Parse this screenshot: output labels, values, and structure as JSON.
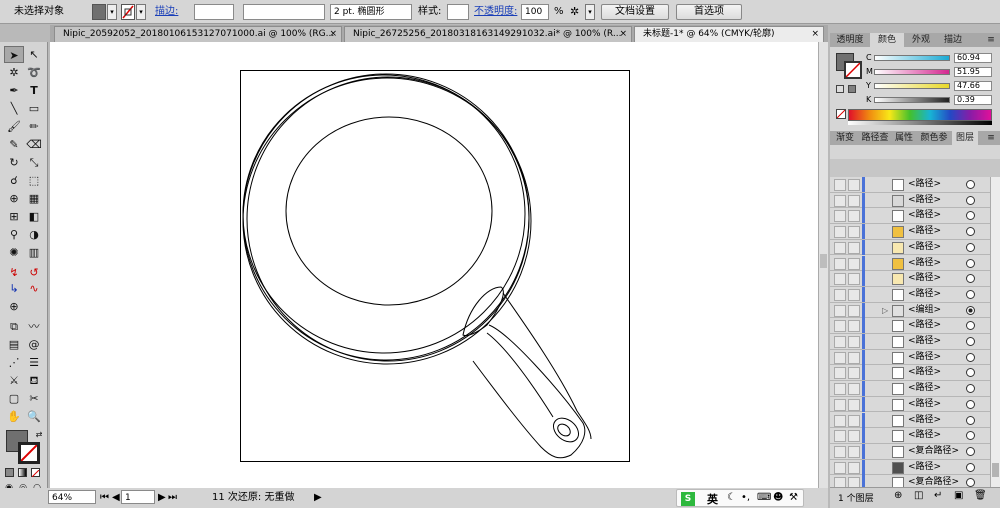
{
  "control_bar": {
    "selection_status": "未选择对象",
    "stroke_label": "描边:",
    "stroke_brush": "2 pt. 椭圆形",
    "style_label": "样式:",
    "opacity_label": "不透明度:",
    "opacity_value": "100",
    "opacity_unit": "%",
    "doc_setup_button": "文档设置",
    "prefs_button": "首选项",
    "fill_color": "#707070"
  },
  "document_tabs": [
    {
      "label": "Nipic_20592052_20180106153127071000.ai @ 100% (RG..."
    },
    {
      "label": "Nipic_26725256_20180318163149291032.ai* @ 100% (R..."
    },
    {
      "label": "未标题-1* @ 64% (CMYK/轮廓)"
    }
  ],
  "status_bar": {
    "zoom": "64%",
    "artboard_number": "1",
    "history": "11 次还原: 无重做"
  },
  "color_panel": {
    "tabs": [
      "透明度",
      "颜色",
      "外观",
      "描边"
    ],
    "active_tab": "颜色",
    "sliders": [
      {
        "channel": "C",
        "value": "60.94",
        "color": "#1aaad4"
      },
      {
        "channel": "M",
        "value": "51.95",
        "color": "#d42890"
      },
      {
        "channel": "Y",
        "value": "47.66",
        "color": "#e8d828"
      },
      {
        "channel": "K",
        "value": "0.39",
        "color": "#222222"
      }
    ]
  },
  "layers_panel": {
    "tabs": [
      "渐变",
      "路径查",
      "属性",
      "颜色参",
      "图层"
    ],
    "active_tab": "图层",
    "rows": [
      {
        "name": "<路径>",
        "thumb": "#ffffff",
        "target": "open"
      },
      {
        "name": "<路径>",
        "thumb": "#d8d8d8",
        "target": "open"
      },
      {
        "name": "<路径>",
        "thumb": "#ffffff",
        "target": "open"
      },
      {
        "name": "<路径>",
        "thumb": "#f0c040",
        "target": "open"
      },
      {
        "name": "<路径>",
        "thumb": "#f8e8b0",
        "target": "open"
      },
      {
        "name": "<路径>",
        "thumb": "#f0c040",
        "target": "open"
      },
      {
        "name": "<路径>",
        "thumb": "#f8e8b0",
        "target": "open"
      },
      {
        "name": "<路径>",
        "thumb": "#ffffff",
        "target": "open"
      },
      {
        "name": "<编组>",
        "thumb": "#e0e0e0",
        "target": "filled",
        "expandable": true
      },
      {
        "name": "<路径>",
        "thumb": "#ffffff",
        "target": "open"
      },
      {
        "name": "<路径>",
        "thumb": "#ffffff",
        "target": "open"
      },
      {
        "name": "<路径>",
        "thumb": "#ffffff",
        "target": "open"
      },
      {
        "name": "<路径>",
        "thumb": "#ffffff",
        "target": "open"
      },
      {
        "name": "<路径>",
        "thumb": "#ffffff",
        "target": "open"
      },
      {
        "name": "<路径>",
        "thumb": "#ffffff",
        "target": "open"
      },
      {
        "name": "<路径>",
        "thumb": "#ffffff",
        "target": "open"
      },
      {
        "name": "<路径>",
        "thumb": "#ffffff",
        "target": "open"
      },
      {
        "name": "<复合路径>",
        "thumb": "#ffffff",
        "target": "open"
      },
      {
        "name": "<路径>",
        "thumb": "#505050",
        "target": "open"
      },
      {
        "name": "<复合路径>",
        "thumb": "#ffffff",
        "target": "open"
      },
      {
        "name": "<复合路径>",
        "thumb": "#f0c040",
        "target": "open"
      },
      {
        "name": "<复合路径>",
        "thumb": "#e8e8e8",
        "target": "open"
      }
    ],
    "footer_label": "1 个图层"
  },
  "ime": {
    "mode": "英"
  }
}
